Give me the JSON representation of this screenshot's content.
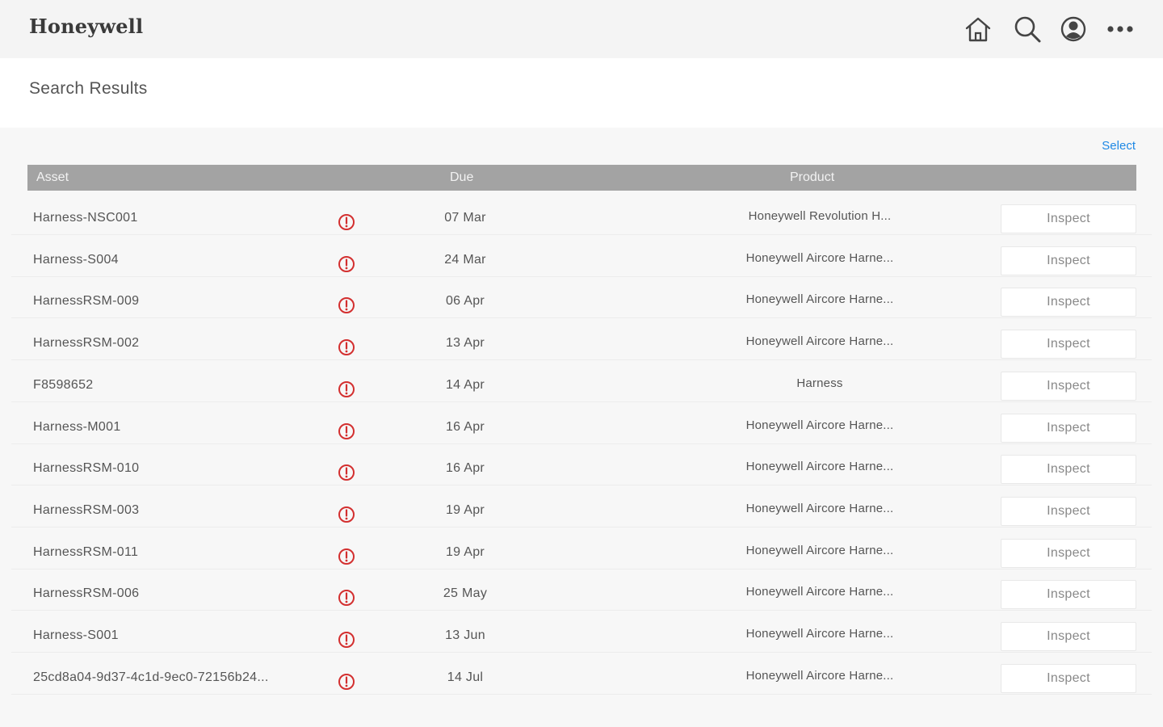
{
  "header": {
    "brand": "Honeywell",
    "icons": [
      "home-icon",
      "search-icon",
      "user-icon",
      "more-icon"
    ]
  },
  "page": {
    "title": "Search Results",
    "select_label": "Select"
  },
  "table": {
    "columns": {
      "asset": "Asset",
      "due": "Due",
      "product": "Product"
    },
    "action_label": "Inspect",
    "alert_color": "#d32f2f",
    "rows": [
      {
        "asset": "Harness-NSC001",
        "due": "07 Mar",
        "product": "Honeywell Revolution H..."
      },
      {
        "asset": "Harness-S004",
        "due": "24 Mar",
        "product": "Honeywell Aircore Harne..."
      },
      {
        "asset": "HarnessRSM-009",
        "due": "06 Apr",
        "product": "Honeywell Aircore Harne..."
      },
      {
        "asset": "HarnessRSM-002",
        "due": "13 Apr",
        "product": "Honeywell Aircore Harne..."
      },
      {
        "asset": "F8598652",
        "due": "14 Apr",
        "product": "Harness"
      },
      {
        "asset": "Harness-M001",
        "due": "16 Apr",
        "product": "Honeywell Aircore Harne..."
      },
      {
        "asset": "HarnessRSM-010",
        "due": "16 Apr",
        "product": "Honeywell Aircore Harne..."
      },
      {
        "asset": "HarnessRSM-003",
        "due": "19 Apr",
        "product": "Honeywell Aircore Harne..."
      },
      {
        "asset": "HarnessRSM-011",
        "due": "19 Apr",
        "product": "Honeywell Aircore Harne..."
      },
      {
        "asset": "HarnessRSM-006",
        "due": "25 May",
        "product": "Honeywell Aircore Harne..."
      },
      {
        "asset": "Harness-S001",
        "due": "13 Jun",
        "product": "Honeywell Aircore Harne..."
      },
      {
        "asset": "25cd8a04-9d37-4c1d-9ec0-72156b24...",
        "due": "14 Jul",
        "product": "Honeywell Aircore Harne..."
      }
    ]
  }
}
